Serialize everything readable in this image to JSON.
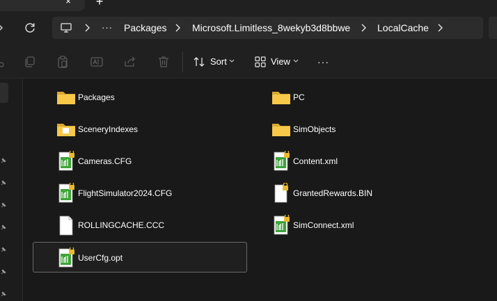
{
  "titlebar": {
    "close_glyph": "×",
    "new_tab_glyph": "+"
  },
  "address": {
    "overflow_glyph": "···",
    "segments": [
      "Packages",
      "Microsoft.Limitless_8wekyb3d8bbwe",
      "LocalCache"
    ]
  },
  "commands": {
    "sort_label": "Sort",
    "view_label": "View",
    "more_glyph": "···"
  },
  "files": [
    {
      "name": "Packages",
      "icon": "folder-icon"
    },
    {
      "name": "PC",
      "icon": "folder-icon"
    },
    {
      "name": "SceneryIndexes",
      "icon": "folder-icon"
    },
    {
      "name": "SimObjects",
      "icon": "folder-icon"
    },
    {
      "name": "Cameras.CFG",
      "icon": "locked-cfg-file-icon"
    },
    {
      "name": "Content.xml",
      "icon": "locked-cfg-file-icon"
    },
    {
      "name": "FlightSimulator2024.CFG",
      "icon": "locked-cfg-file-icon"
    },
    {
      "name": "GrantedRewards.BIN",
      "icon": "locked-blank-file-icon"
    },
    {
      "name": "ROLLINGCACHE.CCC",
      "icon": "blank-file-icon"
    },
    {
      "name": "SimConnect.xml",
      "icon": "locked-cfg-file-icon"
    },
    {
      "name": "UserCfg.opt",
      "icon": "locked-cfg-file-icon",
      "selected": true
    }
  ],
  "colors": {
    "background": "#191919",
    "folder": "#f2c14e",
    "lock": "#e8b931",
    "cfg_green": "#3fa33a"
  }
}
